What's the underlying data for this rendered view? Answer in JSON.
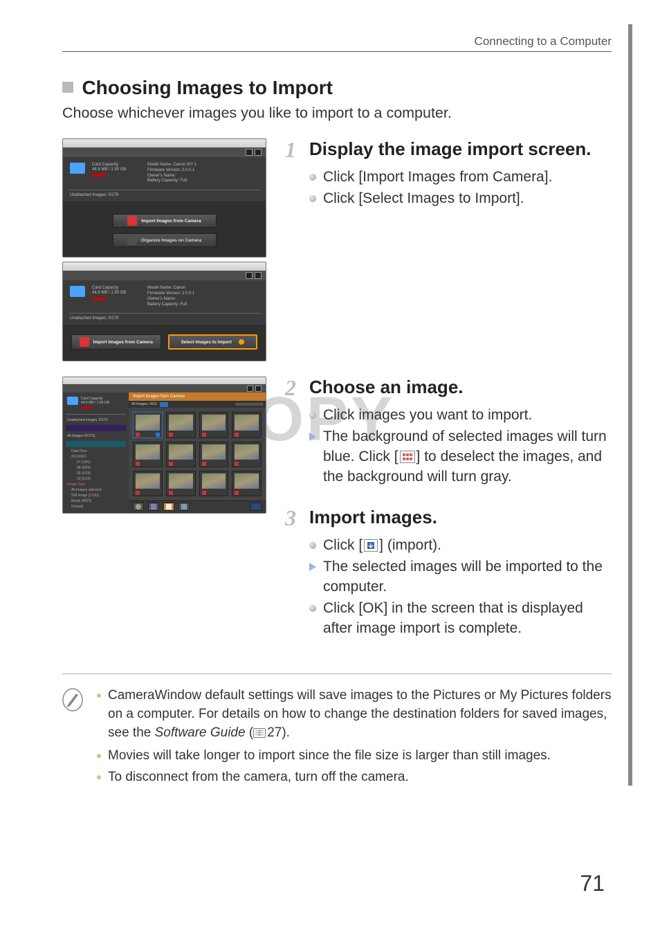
{
  "header": {
    "title": "Connecting to a Computer"
  },
  "section": {
    "title": "Choosing Images to Import",
    "intro": "Choose whichever images you like to import to a computer."
  },
  "watermark": "COPY",
  "mock1": {
    "info_left_1": "Card Capacity",
    "info_left_2": "44.6 MB / 1.50 GB",
    "info_left_3": "Unattached Images: 0/179",
    "info_right_1": "Model Name: Canon IXY 1",
    "info_right_2": "Firmware Version: 2.0.0.1",
    "info_right_3": "Owner's Name:",
    "info_right_4": "Battery Capacity: Full",
    "btn1": "Import Images from Camera",
    "btn2": "Organize Images on Camera"
  },
  "mock2": {
    "info_left_1": "Card Capacity",
    "info_left_2": "44.6 MB / 1.50 GB",
    "info_left_3": "Unattached Images: 0/179",
    "info_right_1": "Model Name: Canon",
    "info_right_2": "Firmware Version: 2.0.0.1",
    "info_right_3": "Owner's Name:",
    "info_right_4": "Battery Capacity: Full",
    "btnA": "Import Images from Camera",
    "btnB": "Select Images to Import"
  },
  "mock3": {
    "hdr": "Import Images from Camera",
    "label": "All Images: 0/0/1",
    "side_1": "Card Capacity",
    "side_2": "44.6 MB / 1.50 GB",
    "side_3": "Unattached images: 0/179",
    "chip1": "All Images (0/179)",
    "chip2": "Unattached Images (0/179)",
    "tree_root": "Date/Time",
    "tree_1": "2011/09/1",
    "tree_2": "07 (1/41)",
    "tree_3": "08 (0/99)",
    "tree_4": "09 (0/26)",
    "tree_5": "13 (0/10)",
    "hdr2": "Image Type",
    "line_a": "All Images selected",
    "line_b": "Still Image (179/1)",
    "line_c": "Movie (0/0/1)",
    "line_d": "Unused"
  },
  "steps": [
    {
      "num": "1",
      "title": "Display the image import screen.",
      "items": [
        {
          "kind": "dot",
          "text": "Click [Import Images from Camera]."
        },
        {
          "kind": "dot",
          "text": "Click [Select Images to Import]."
        }
      ]
    },
    {
      "num": "2",
      "title": "Choose an image.",
      "items": [
        {
          "kind": "dot",
          "text": "Click images you want to import."
        },
        {
          "kind": "arrow",
          "pre": "The background of selected images will turn blue. Click [",
          "post": "] to deselect the images, and the background will turn gray."
        }
      ]
    },
    {
      "num": "3",
      "title": "Import images.",
      "items": [
        {
          "kind": "dot",
          "pre": "Click [",
          "post": "] (import)."
        },
        {
          "kind": "arrow",
          "text": "The selected images will be imported to the computer."
        },
        {
          "kind": "dot",
          "text": "Click [OK] in the screen that is displayed after image import is complete."
        }
      ]
    }
  ],
  "notes": [
    {
      "pre": "CameraWindow default settings will save images to the Pictures or My Pictures folders on a computer. For details on how to change the destination folders for saved images, see the ",
      "mid": " (",
      "page": "27",
      "post": ")."
    },
    {
      "text": "Movies will take longer to import since the file size is larger than still images."
    },
    {
      "text": "To disconnect from the camera, turn off the camera."
    }
  ],
  "pageNumber": "71"
}
